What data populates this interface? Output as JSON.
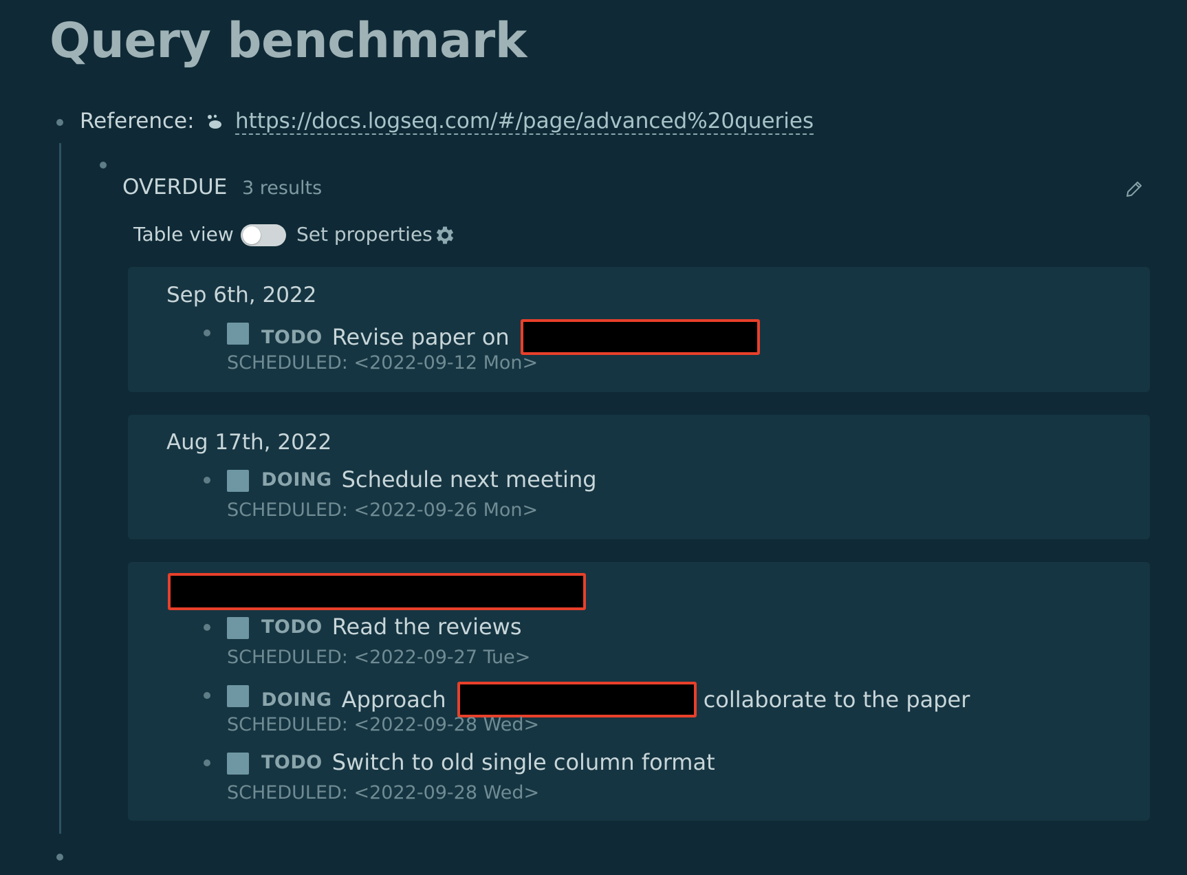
{
  "page": {
    "title": "Query benchmark"
  },
  "reference": {
    "label": "Reference:",
    "link": "https://docs.logseq.com/#/page/advanced%20queries",
    "icon": "logseq-icon"
  },
  "query": {
    "title": "OVERDUE",
    "count": "3 results",
    "table_view_label": "Table view",
    "table_view_enabled": false,
    "set_properties_label": "Set properties",
    "scheduled_label": "SCHEDULED:",
    "groups": [
      {
        "date": "Sep 6th, 2022",
        "tasks": [
          {
            "marker": "TODO",
            "text": "Revise paper on",
            "scheduled": "<2022-09-12 Mon>"
          }
        ]
      },
      {
        "date": "Aug 17th, 2022",
        "tasks": [
          {
            "marker": "DOING",
            "text": "Schedule next meeting",
            "scheduled": "<2022-09-26 Mon>"
          }
        ]
      },
      {
        "date": "",
        "tasks": [
          {
            "marker": "TODO",
            "text": "Read the reviews",
            "scheduled": "<2022-09-27 Tue>"
          },
          {
            "marker": "DOING",
            "text": "Approach",
            "text_after": "collaborate to the paper",
            "scheduled": "<2022-09-28 Wed>"
          },
          {
            "marker": "TODO",
            "text": "Switch to old single column format",
            "scheduled": "<2022-09-28 Wed>"
          }
        ]
      }
    ]
  },
  "colors": {
    "background": "#0f2a36",
    "card": "#163542",
    "checkbox": "#6e97a3",
    "redaction_border": "#e8402a"
  }
}
